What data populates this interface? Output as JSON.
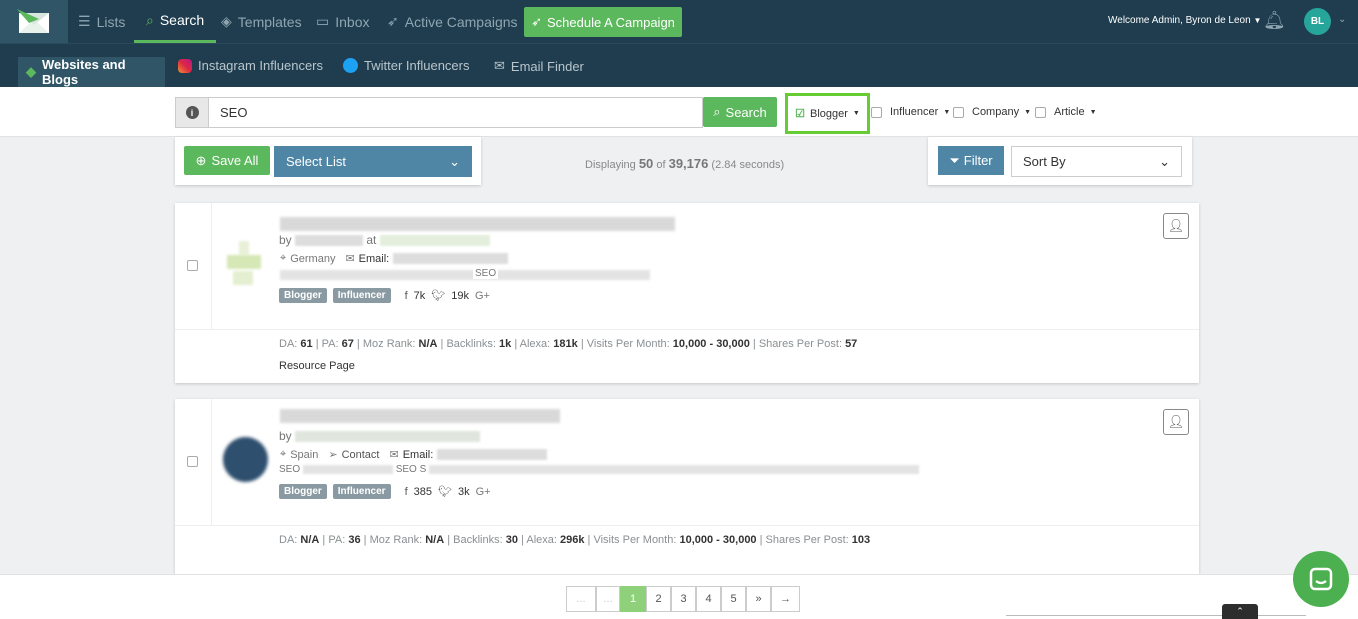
{
  "nav": {
    "items": [
      "Lists",
      "Search",
      "Templates",
      "Inbox",
      "Active Campaigns"
    ],
    "schedule_btn": "Schedule A Campaign",
    "welcome": "Welcome Admin, Byron de Leon",
    "avatar_initials": "BL"
  },
  "subnav": {
    "items": [
      "Websites and Blogs",
      "Instagram Influencers",
      "Twitter Influencers",
      "Email Finder"
    ]
  },
  "search": {
    "value": "SEO",
    "button": "Search",
    "filters": [
      "Blogger",
      "Influencer",
      "Company",
      "Article"
    ]
  },
  "toolbar": {
    "save_all": "Save All",
    "select_list": "Select List",
    "displaying_prefix": "Displaying",
    "count": "50",
    "of": "of",
    "total": "39,176",
    "time": "(2.84 seconds)",
    "filter": "Filter",
    "sort_by": "Sort By"
  },
  "results": [
    {
      "by": "by",
      "at": "at",
      "country": "Germany",
      "email_label": "Email:",
      "desc_frag": "SEO",
      "badges": [
        "Blogger",
        "Influencer"
      ],
      "facebook": "7k",
      "twitter": "19k",
      "gplus": "G+",
      "stats": {
        "da": "61",
        "pa": "67",
        "moz": "N/A",
        "backlinks": "1k",
        "alexa": "181k",
        "visits": "10,000 - 30,000",
        "shares": "57"
      },
      "resource": "Resource Page"
    },
    {
      "by": "by",
      "country": "Spain",
      "contact": "Contact",
      "email_label": "Email:",
      "desc_frag_1": "SEO",
      "desc_frag_2": "SEO S",
      "badges": [
        "Blogger",
        "Influencer"
      ],
      "facebook": "385",
      "twitter": "3k",
      "gplus": "G+",
      "stats": {
        "da": "N/A",
        "pa": "36",
        "moz": "N/A",
        "backlinks": "30",
        "alexa": "296k",
        "visits": "10,000 - 30,000",
        "shares": "103"
      }
    }
  ],
  "stat_labels": {
    "da": "DA:",
    "pa": "PA:",
    "moz": "Moz Rank:",
    "backlinks": "Backlinks:",
    "alexa": "Alexa:",
    "visits": "Visits Per Month:",
    "shares": "Shares Per Post:"
  },
  "pagination": {
    "first": "...",
    "prev": "...",
    "pages": [
      "1",
      "2",
      "3",
      "4",
      "5"
    ],
    "next": "»",
    "last": "→"
  },
  "colors": {
    "nav_bg": "#1f3d4e",
    "accent_green": "#5cb85c",
    "select_blue": "#4f86a6",
    "highlight": "#66cc33"
  }
}
